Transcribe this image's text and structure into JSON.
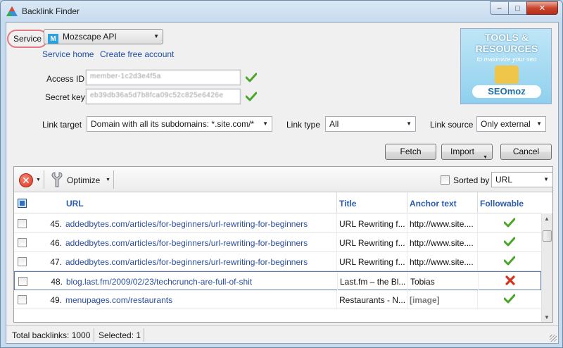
{
  "window": {
    "title": "Backlink Finder",
    "minimize": "–",
    "maximize": "□",
    "close": "✕"
  },
  "service": {
    "label": "Service",
    "selected": "Mozscape API",
    "icon_letter": "M",
    "links": {
      "home": "Service home",
      "create": "Create free account"
    }
  },
  "credentials": {
    "access_id_label": "Access ID",
    "access_id_value": "member-1c2d3e4f5a",
    "secret_key_label": "Secret key",
    "secret_key_value": "eb39db36a5d7b8fca09c52c825e6426e"
  },
  "ad": {
    "line1": "TOOLS &",
    "line2": "RESOURCES",
    "line3": "to maximize your seo",
    "brand": "SEOmoz"
  },
  "filters": {
    "link_target_label": "Link target",
    "link_target_value": "Domain with all its subdomains: *.site.com/*",
    "link_type_label": "Link type",
    "link_type_value": "All",
    "link_source_label": "Link source",
    "link_source_value": "Only external"
  },
  "actions": {
    "fetch": "Fetch",
    "import": "Import",
    "cancel": "Cancel"
  },
  "toolbar": {
    "optimize": "Optimize",
    "sorted_by_label": "Sorted by",
    "sorted_by_value": "URL"
  },
  "table": {
    "columns": {
      "url": "URL",
      "title": "Title",
      "anchor": "Anchor text",
      "followable": "Followable"
    },
    "rows": [
      {
        "num": "45.",
        "url": "addedbytes.com/articles/for-beginners/url-rewriting-for-beginners",
        "title": "URL Rewriting f...",
        "anchor": "http://www.site....",
        "followable": true
      },
      {
        "num": "46.",
        "url": "addedbytes.com/articles/for-beginners/url-rewriting-for-beginners",
        "title": "URL Rewriting f...",
        "anchor": "http://www.site....",
        "followable": true
      },
      {
        "num": "47.",
        "url": "addedbytes.com/articles/for-beginners/url-rewriting-for-beginners",
        "title": "URL Rewriting f...",
        "anchor": "http://www.site....",
        "followable": true
      },
      {
        "num": "48.",
        "url": "blog.last.fm/2009/02/23/techcrunch-are-full-of-shit",
        "title": "Last.fm – the Bl...",
        "anchor": "Tobias",
        "followable": false
      },
      {
        "num": "49.",
        "url": "menupages.com/restaurants",
        "title": "Restaurants - N...",
        "anchor": "[image]",
        "followable": true
      }
    ]
  },
  "status": {
    "total": "Total backlinks: 1000",
    "selected": "Selected: 1"
  },
  "colors": {
    "link": "#1d4fa8",
    "check_green": "#4aa62a",
    "cross_red": "#d8321c",
    "service_highlight": "#e27b86"
  }
}
